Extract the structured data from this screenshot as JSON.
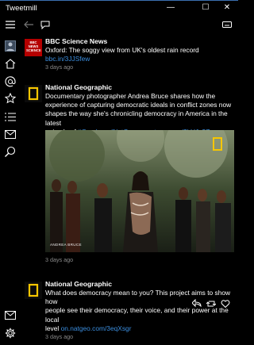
{
  "window": {
    "title": "Tweetmill",
    "controls": {
      "minimize": "—",
      "maximize": "☐",
      "close": "✕"
    }
  },
  "tweets": [
    {
      "author": "BBC Science News",
      "avatar_text": [
        "BBC",
        "NEWS",
        "SCIENCE"
      ],
      "text": "Oxford: The soggy view from UK's oldest rain record ",
      "link": "bbc.in/3JJSfew",
      "time": "3 days ago"
    },
    {
      "author": "National Geographic",
      "text_lines": [
        "Documentary photographer Andrea Bruce shares how the",
        "experience of capturing democratic ideals in conflict zones now",
        "shapes the way she's chronicling democracy in America in the latest"
      ],
      "text_last": "episode of ",
      "hashtag": "#OverheardNatGeo",
      "link": "on.natgeo.com/3kUJx2Z",
      "photo_credit": "ANDREA BRUCE",
      "time": "3 days ago"
    },
    {
      "author": "National Geographic",
      "text_lines": [
        "What does democracy mean to you? This project aims to show how",
        "people see their democracy, their voice, and their power at the local"
      ],
      "text_last": "level ",
      "link": "on.natgeo.com/3eqXsgr",
      "time": "3 days ago"
    }
  ],
  "colors": {
    "link": "#3b8ddd",
    "natgeo_yellow": "#f7c600",
    "bbc_red": "#b50000",
    "accent_titlebar": "#3a6fb0"
  },
  "icons": {
    "toolbar": [
      "menu-icon",
      "back-arrow-icon",
      "compose-icon",
      "keyboard-icon"
    ],
    "sidebar": [
      "account-icon",
      "home-icon",
      "mentions-icon",
      "favorites-icon",
      "lists-icon",
      "messages-icon",
      "search-icon",
      "direct-message-icon",
      "settings-icon"
    ],
    "tweet_actions": [
      "reply-icon",
      "retweet-icon",
      "like-icon"
    ]
  }
}
